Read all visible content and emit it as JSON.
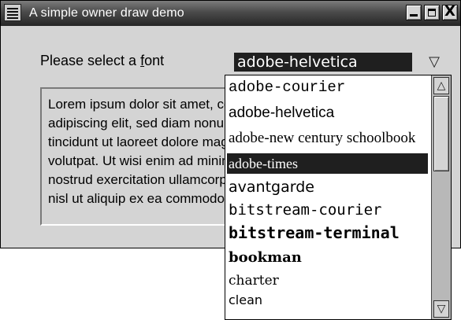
{
  "window": {
    "title": "A simple owner draw demo",
    "close_glyph": "X"
  },
  "prompt": {
    "before": "Please select a ",
    "mnemonic": "f",
    "after": "ont"
  },
  "combo": {
    "selected_value": "adobe-helvetica",
    "arrow_glyph": "▽"
  },
  "text_preview": {
    "lines": [
      "Lorem ipsum dolor sit amet, consectetuer",
      "adipiscing elit, sed diam nonummy nibh euismod",
      "tincidunt ut laoreet dolore magna aliquam erat",
      "volutpat. Ut wisi enim ad minim veniam, quis",
      "nostrud exercitation ullamcorper suscipit lobortis",
      "nisl ut aliquip ex ea commodo consequat."
    ]
  },
  "font_list": {
    "items": [
      "adobe-courier",
      "adobe-helvetica",
      "adobe-new century schoolbook",
      "adobe-times",
      "avantgarde",
      "bitstream-courier",
      "bitstream-terminal",
      "bookman",
      "charter",
      "clean"
    ],
    "highlighted": "adobe-times",
    "scroll_up_glyph": "△",
    "scroll_down_glyph": "▽"
  }
}
